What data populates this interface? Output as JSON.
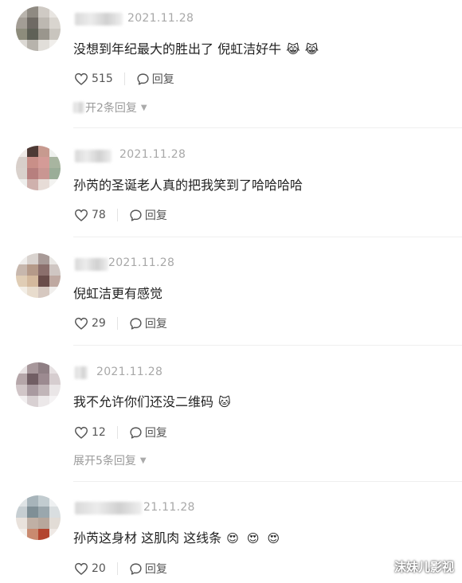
{
  "comments": [
    {
      "date": "2021.11.28",
      "text": "没想到年纪最大的胜出了 倪虹洁好牛",
      "emojis": [
        "😹",
        "😹"
      ],
      "likes": "515",
      "reply_label": "回复",
      "expand_label": "开2条回复"
    },
    {
      "date": "2021.11.28",
      "text": "孙芮的圣诞老人真的把我笑到了哈哈哈哈",
      "emojis": [],
      "likes": "78",
      "reply_label": "回复"
    },
    {
      "date": "2021.11.28",
      "text": "倪虹洁更有感觉",
      "emojis": [],
      "likes": "29",
      "reply_label": "回复"
    },
    {
      "date": "2021.11.28",
      "text": "我不允许你们还没二维码",
      "emojis": [
        "🐱"
      ],
      "likes": "12",
      "reply_label": "回复",
      "expand_label": "展开5条回复"
    },
    {
      "date": "21.11.28",
      "text": "孙芮这身材 这肌肉 这线条",
      "emojis": [
        "😍",
        "😍",
        "😍"
      ],
      "likes": "20",
      "reply_label": "回复"
    }
  ],
  "watermark": "沫妹儿影视",
  "icons": {
    "like": "heart-outline-icon",
    "reply": "speech-bubble-icon",
    "expand": "caret-down-icon"
  },
  "colors": {
    "text": "#222222",
    "muted": "#a8a8a8",
    "action": "#555555"
  }
}
